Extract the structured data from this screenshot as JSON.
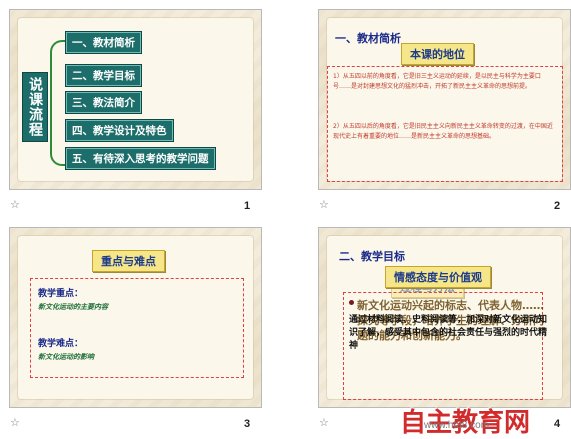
{
  "slides": [
    {
      "number": "1",
      "vertical_title": "说课流程",
      "items": [
        "一、教材简析",
        "二、教学目标",
        "三、教法简介",
        "四、教学设计及特色",
        "五、有待深入思考的教学问题"
      ]
    },
    {
      "number": "2",
      "heading": "一、教材简析",
      "pill": "本课的地位",
      "paragraph1": "1）从五四以前的角度看，它是旧三主义运动的延续，是以民主与科学为主要口号……是对封建思想文化的猛烈冲击，开拓了新民主主义革命的思想前提。",
      "paragraph2": "2）从五四以后的角度看，它是旧民主主义向新民主主义革命转变的过渡，在中国近现代史上有着重要的地位……是新民主主义革命的思想基础。"
    },
    {
      "number": "3",
      "pill": "重点与难点",
      "focus_label": "教学重点：",
      "focus_text": "新文化运动的主要内容",
      "difficulty_label": "教学难点：",
      "difficulty_text": "新文化运动的影响"
    },
    {
      "number": "4",
      "heading": "二、教学目标",
      "pill": "情感态度与价值观",
      "pill_ghost": "过程与方法",
      "under_text": "新文化运动兴起的标志、代表人物……探究等手段，培养学生的理解、分析问题的能力和创新能力。",
      "over_text": "通过材料阅读、史料阅读等，加深对新文化运动知识了解，感受其中包含的社会责任与强烈的时代精神"
    }
  ],
  "star_glyph": "☆",
  "watermark": {
    "text": "自主教育网",
    "url": "www.ht88.com"
  },
  "colors": {
    "teal": "#1d6e6b",
    "navy": "#1a2a8a",
    "red": "#c0392b",
    "pill": "#f6e68a"
  }
}
